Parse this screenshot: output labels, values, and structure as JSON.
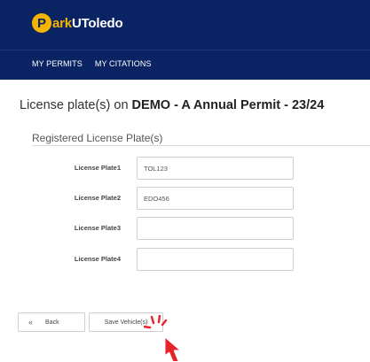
{
  "brand": {
    "logo_letter": "P",
    "logo_accent": "ark",
    "logo_rest": "UToledo"
  },
  "nav": {
    "items": [
      "MY PERMITS",
      "MY CITATIONS"
    ]
  },
  "page": {
    "title_prefix": "License plate(s) on ",
    "title_bold": "DEMO - A Annual Permit - 23/24"
  },
  "section": {
    "title": "Registered License Plate(s)"
  },
  "plates": [
    {
      "label": "License Plate1",
      "value": "TOL123"
    },
    {
      "label": "License Plate2",
      "value": "EDO456"
    },
    {
      "label": "License Plate3",
      "value": ""
    },
    {
      "label": "License Plate4",
      "value": ""
    }
  ],
  "actions": {
    "back_icon": "«",
    "back_label": "Back",
    "save_label": "Save Vehicle(s)"
  },
  "colors": {
    "header_bg": "#0a2463",
    "logo_yellow": "#f5b400",
    "cursor_red": "#e8242b"
  },
  "icons": {
    "logo": "parking-p-icon",
    "cursor": "hand-pointer-icon"
  }
}
